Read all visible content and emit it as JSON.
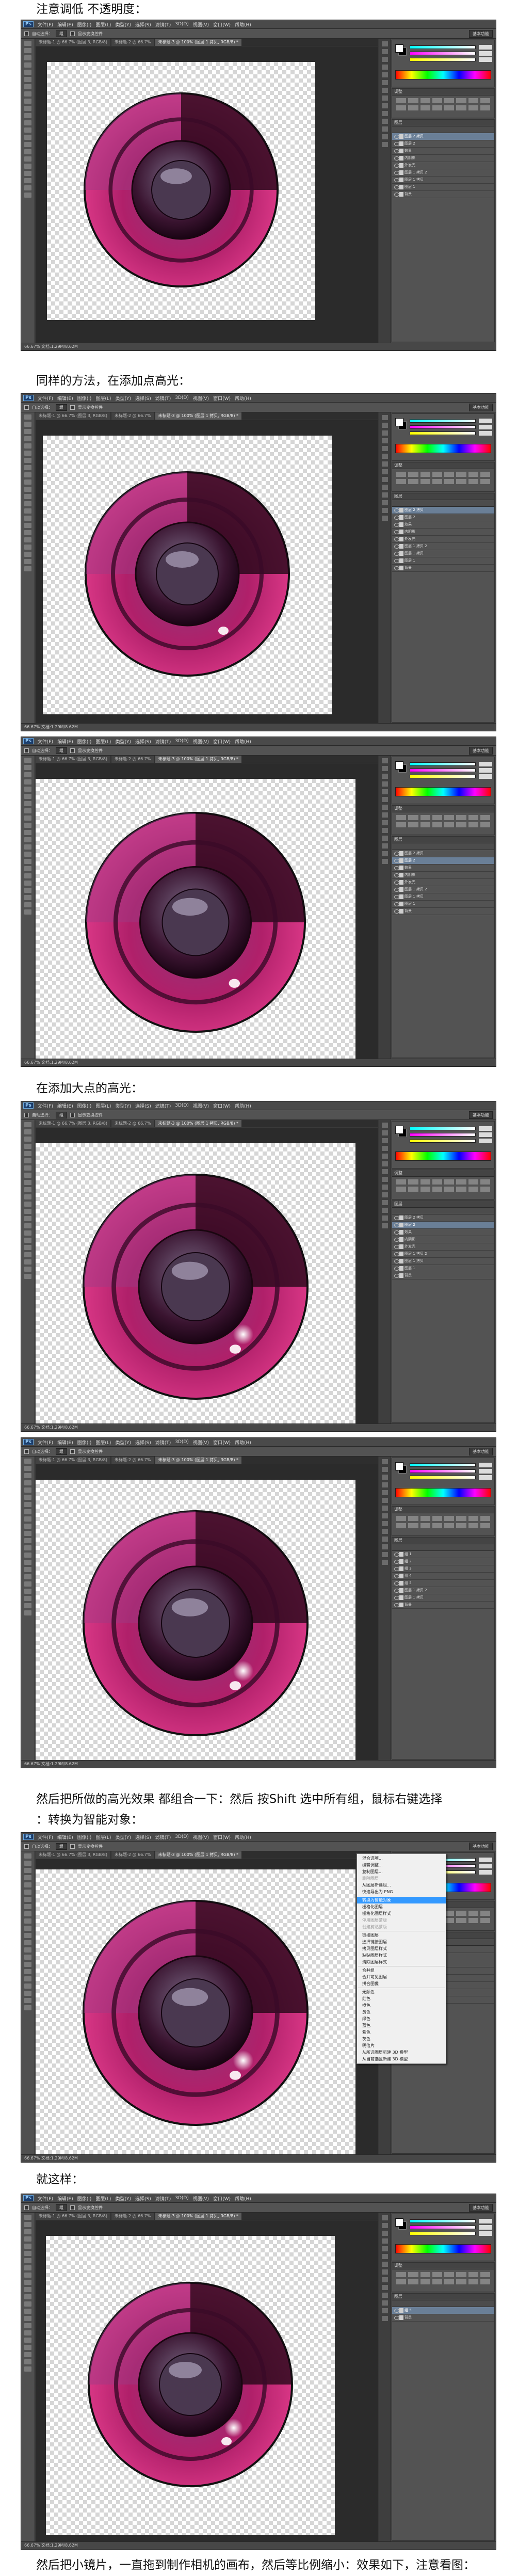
{
  "captions": [
    "注意调低  不透明度：",
    "同样的方法，在添加点高光：",
    "在添加大点的高光：",
    "然后把所做的高光效果  都组合一下：然后 按Shift 选中所有组，鼠标右键选择",
    "：转换为智能对象：",
    "就这样：",
    "然后把小镜片，一直拖到制作相机的画布，然后等比例缩小：效果如下，注意看图："
  ],
  "app": {
    "logo": "Ps",
    "menu": [
      "文件(F)",
      "编辑(E)",
      "图像(I)",
      "图层(L)",
      "类型(Y)",
      "选择(S)",
      "滤镜(T)",
      "3D(D)",
      "视图(V)",
      "窗口(W)",
      "帮助(H)"
    ],
    "options": [
      "自动选择：",
      "组",
      "显示变换控件"
    ],
    "workspace": "基本功能",
    "tabs": [
      "未标题-1 @ 66.7% (图层 3, RGB/8)",
      "未标题-2 @ 66.7%",
      "未标题-3 @ 100% (图层 1 拷贝, RGB/8) *"
    ],
    "status": "66.67%     文档:1.29M/8.62M",
    "panels": {
      "color_title": "颜色",
      "adjust_title": "调整",
      "adjust_hint": "添加调整",
      "layers_title": "图层",
      "layers": [
        "图层 2 拷贝",
        "图层 2",
        "效果",
        "内阴影",
        "外发光",
        "图层 1 拷贝 2",
        "图层 1 拷贝",
        "图层 1",
        "背景"
      ],
      "layers_group": [
        "组 1",
        "组 2",
        "组 3",
        "组 4",
        "组 5",
        "图层 1 拷贝 2",
        "图层 1 拷贝",
        "背景"
      ],
      "layers_smart": [
        "组 5",
        "背景"
      ]
    }
  },
  "context_menu": [
    "混合选项...",
    "编辑调整...",
    "复制图层...",
    "删除图层",
    "从图层新建组...",
    "快速导出为 PNG",
    "转换为智能对象",
    "栅格化图层",
    "栅格化图层样式",
    "停用图层蒙版",
    "创建剪贴蒙版",
    "链接图层",
    "选择链接图层",
    "拷贝图层样式",
    "粘贴图层样式",
    "清除图层样式",
    "合并组",
    "合并可见图层",
    "拼合图像",
    "无颜色",
    "红色",
    "橙色",
    "黄色",
    "绿色",
    "蓝色",
    "紫色",
    "灰色",
    "明信片",
    "从所选图层新建 3D 模型",
    "从当前选区新建 3D 模型"
  ],
  "colors": {
    "accent": "#3399ff",
    "lens_pink": "#e0277c",
    "lens_dark": "#2a0820"
  }
}
